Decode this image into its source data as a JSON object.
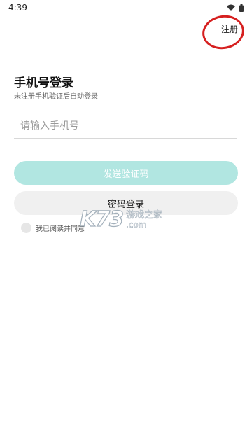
{
  "status_bar": {
    "time": "4:39"
  },
  "header": {
    "register_label": "注册"
  },
  "login": {
    "title": "手机号登录",
    "subtitle": "未注册手机验证后自动登录",
    "phone_placeholder": "请输入手机号",
    "send_code_label": "发送验证码",
    "password_login_label": "密码登录",
    "agreement_text": "我已阅读并同意"
  },
  "watermark": {
    "logo": "K73",
    "site": "游戏之家",
    "domain": ".com"
  },
  "colors": {
    "accent_disabled": "#b1e6e1",
    "secondary_button": "#f0f0f0",
    "annotation": "#d62020"
  }
}
